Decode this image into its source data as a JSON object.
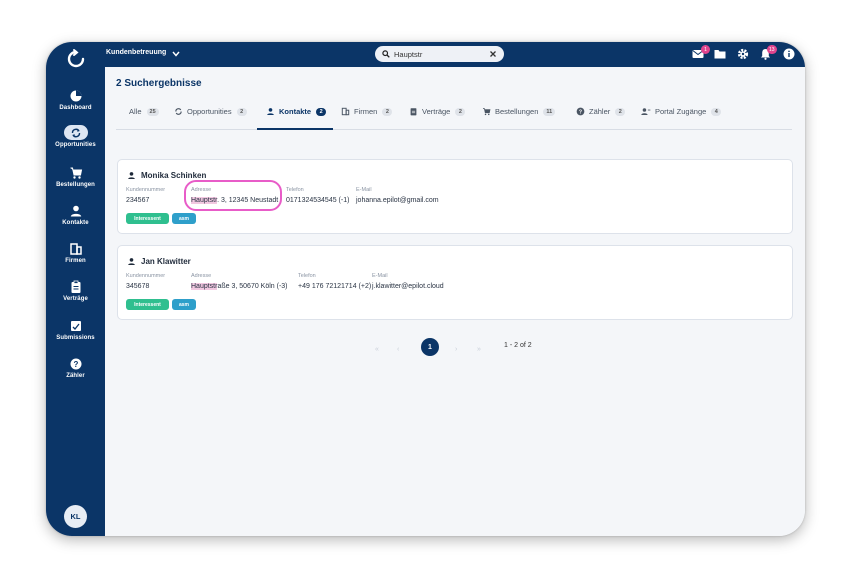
{
  "topbar": {
    "app_name": "Kundenbetreuung",
    "search_value": "Hauptstr",
    "mail_badge": "1",
    "notif_badge": "13"
  },
  "sidebar": {
    "items": [
      {
        "label": "Dashboard",
        "icon": "dashboard-icon"
      },
      {
        "label": "Opportunities",
        "icon": "sync-icon"
      },
      {
        "label": "Bestellungen",
        "icon": "cart-icon"
      },
      {
        "label": "Kontakte",
        "icon": "person-icon"
      },
      {
        "label": "Firmen",
        "icon": "building-icon"
      },
      {
        "label": "Verträge",
        "icon": "clipboard-icon"
      },
      {
        "label": "Submissions",
        "icon": "inbox-icon"
      },
      {
        "label": "Zähler",
        "icon": "question-icon"
      }
    ],
    "avatar": "KL"
  },
  "results_title": "2 Suchergebnisse",
  "tabs": [
    {
      "label": "Alle",
      "count": "25"
    },
    {
      "label": "Opportunities",
      "count": "2"
    },
    {
      "label": "Kontakte",
      "count": "2"
    },
    {
      "label": "Firmen",
      "count": "2"
    },
    {
      "label": "Verträge",
      "count": "2"
    },
    {
      "label": "Bestellungen",
      "count": "11"
    },
    {
      "label": "Zähler",
      "count": "2"
    },
    {
      "label": "Portal Zugänge",
      "count": "4"
    }
  ],
  "labels": {
    "customer_number": "Kundennummer",
    "address": "Adresse",
    "phone": "Telefon",
    "email": "E-Mail"
  },
  "contacts": [
    {
      "name": "Monika Schinken",
      "customer_number": "234567",
      "address_highlight": "Hauptstr",
      "address_rest": ". 3, 12345 Neustadt",
      "phone": "017132453454​5 (-1)",
      "email": "johanna.epilot@gmail.com",
      "tags": [
        "Interessent",
        "asm"
      ]
    },
    {
      "name": "Jan Klawitter",
      "customer_number": "345678",
      "address_highlight": "Hauptstr",
      "address_rest": "aße 3, 50670 Köln (-3)",
      "phone": "+49 176 72121714 (+2)",
      "email": "j.klawitter@epilot.cloud",
      "tags": [
        "Interessent",
        "asm"
      ]
    }
  ],
  "pagination": {
    "current": "1",
    "info": "1 - 2 of 2"
  }
}
